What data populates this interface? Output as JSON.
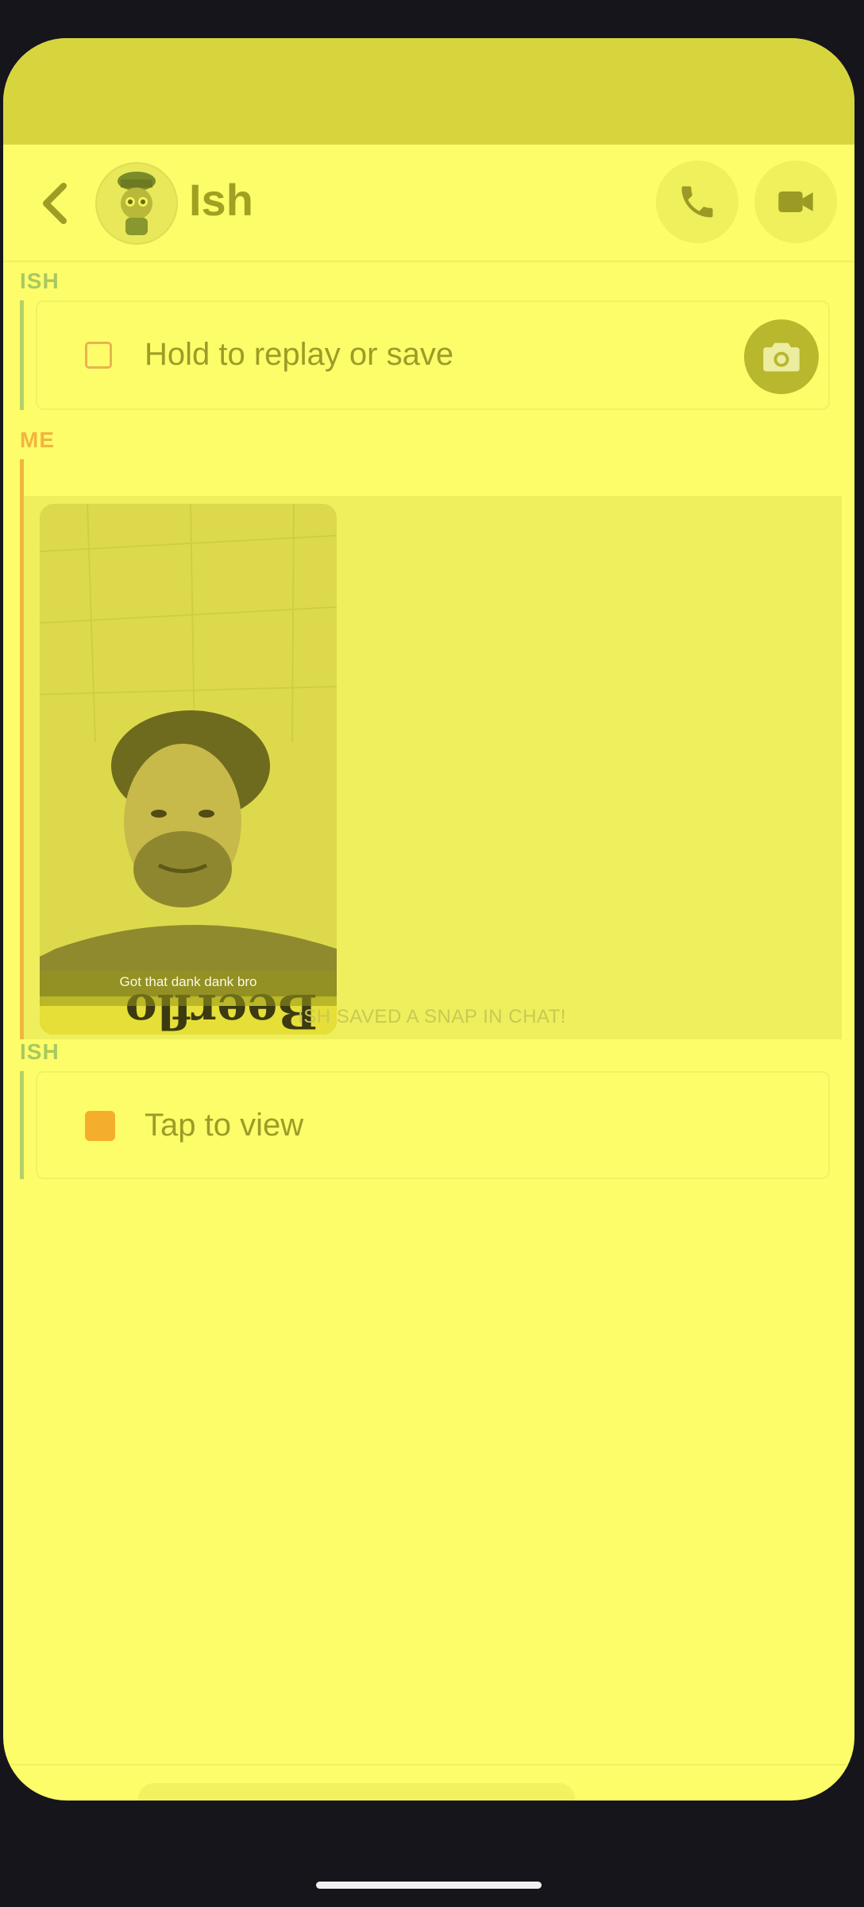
{
  "header": {
    "friend_name": "Ish",
    "icons": {
      "back": "chevron-left-icon",
      "call": "phone-icon",
      "video": "video-camera-icon"
    }
  },
  "messages": [
    {
      "sender": "ISH",
      "text": "Hold to replay or save",
      "status": "opened-snap",
      "action_icon": "camera-icon"
    },
    {
      "sender": "ME",
      "type": "saved-snap",
      "caption": "Got that dank dank bro"
    },
    {
      "sender": "ISH",
      "text": "Tap to view",
      "status": "unopened-snap"
    }
  ],
  "system_note": "ISH SAVED A SNAP IN CHAT!",
  "colors": {
    "background": "#fdfd6a",
    "ish_accent": "#b6cf6a",
    "me_accent": "#f2b53e",
    "snap_orange": "#f5ae2c"
  }
}
